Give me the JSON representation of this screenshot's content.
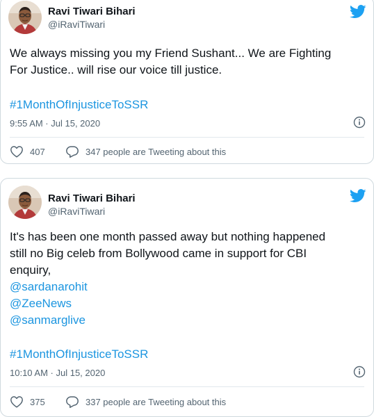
{
  "tweets": [
    {
      "author_name": "Ravi Tiwari Bihari",
      "handle": "@iRaviTiwari",
      "text_lines": [
        "We always missing you my Friend Sushant... We are Fighting",
        "For Justice.. will rise our voice till justice."
      ],
      "mentions": [],
      "hashtag": "#1MonthOfInjusticeToSSR",
      "timestamp": "9:55 AM · Jul 15, 2020",
      "likes": "407",
      "tweeting_text": "347 people are Tweeting about this"
    },
    {
      "author_name": "Ravi Tiwari Bihari",
      "handle": "@iRaviTiwari",
      "text_lines": [
        "It's has been one month passed away but nothing happened",
        "still no Big celeb from Bollywood came in support for CBI",
        "enquiry,"
      ],
      "mentions": [
        "@sardanarohit",
        "@ZeeNews",
        "@sanmarglive"
      ],
      "hashtag": "#1MonthOfInjusticeToSSR",
      "timestamp": "10:10 AM · Jul 15, 2020",
      "likes": "375",
      "tweeting_text": "337 people are Tweeting about this"
    }
  ],
  "colors": {
    "link": "#1b95e0",
    "twitter_blue": "#1da1f2",
    "muted": "#536471",
    "border": "#cfd9de"
  },
  "icons": [
    "twitter-bird-icon",
    "info-icon",
    "heart-icon",
    "speech-bubble-icon"
  ]
}
